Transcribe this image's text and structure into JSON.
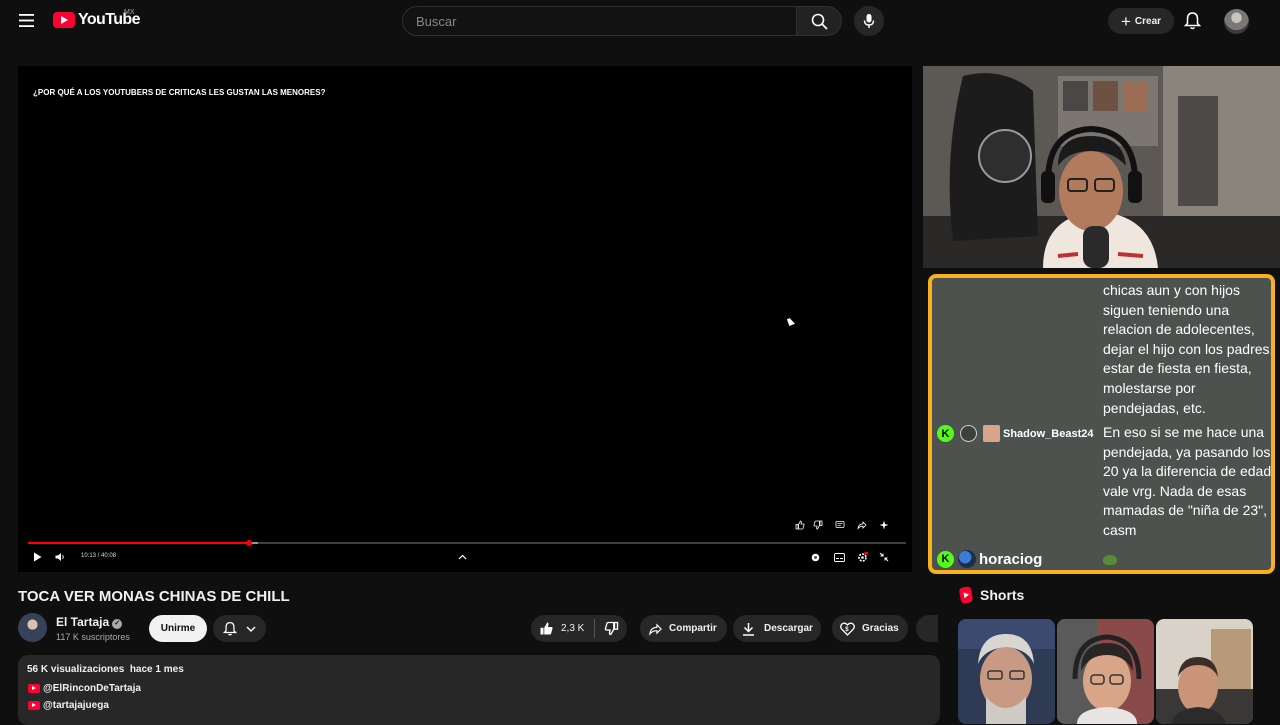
{
  "header": {
    "logo_text": "YouTube",
    "country": "MX",
    "search_placeholder": "Buscar",
    "create_label": "Crear"
  },
  "player": {
    "overlay_title": "¿POR QUÉ A LOS YOUTUBERS DE CRITICAS LES GUSTAN LAS MENORES?",
    "time": "10:13 / 40:08",
    "progress_fraction": 0.252,
    "buffer_fraction": 0.262
  },
  "chat": {
    "messages": [
      {
        "text": "chicas aun y con hijos siguen teniendo una relacion de adolecentes, dejar el hijo con los padres, estar de fiesta en fiesta, molestarse por pendejadas, etc."
      },
      {
        "username": "Shadow_Beast24",
        "text": "En eso si se me hace una pendejada, ya pasando los 20 ya la diferencia de edad vale vrg. Nada de esas mamadas de \"niña de 23\", casm"
      },
      {
        "username": "horaciog",
        "text": ""
      }
    ]
  },
  "video": {
    "title": "TOCA VER MONAS CHINAS DE CHILL",
    "channel": "El Tartaja",
    "subscribers": "117 K suscriptores",
    "join_label": "Unirme",
    "likes": "2,3 K",
    "share_label": "Compartir",
    "download_label": "Descargar",
    "thanks_label": "Gracias"
  },
  "description": {
    "meta": "56 K visualizaciones  hace 1 mes",
    "links": [
      "@ElRinconDeTartaja",
      "@tartajajuega"
    ]
  },
  "shorts": {
    "heading": "Shorts"
  },
  "colors": {
    "accent_red": "#ff0033",
    "chat_border": "#f8b11b",
    "kick_green": "#53fc18"
  }
}
